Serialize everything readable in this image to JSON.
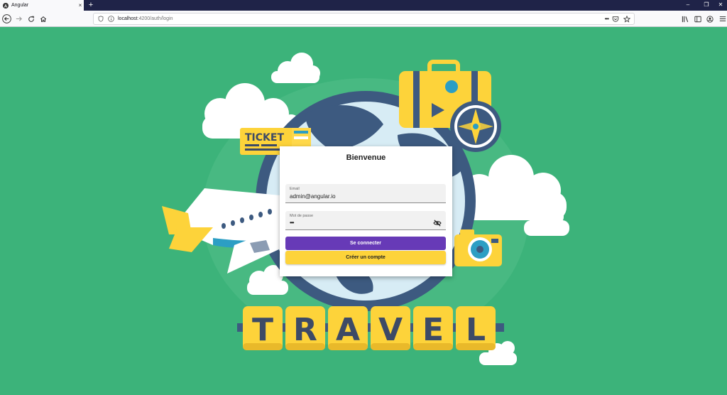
{
  "browser": {
    "tab_title": "Angular",
    "tab_close": "×",
    "new_tab": "+",
    "url_host": "localhost",
    "url_path": ":4200/auth/login",
    "more_actions": "•••",
    "window_minimize": "–",
    "window_restore": "❐",
    "window_close": "✕"
  },
  "illustration": {
    "ticket_label": "TICKET",
    "travel_letters": [
      "T",
      "R",
      "A",
      "V",
      "E",
      "L"
    ]
  },
  "login": {
    "title": "Bienvenue",
    "email_label": "Email",
    "email_value": "admin@angular.io",
    "password_label": "Mot de passe",
    "password_value": "•••",
    "submit_label": "Se connecter",
    "register_label": "Créer un compte"
  },
  "colors": {
    "background": "#3cb37a",
    "primary": "#673ab7",
    "accent": "#fdd33a",
    "globe_blue": "#3d5a80",
    "letters_text": "#3d4a66"
  },
  "icons": {
    "tab": "angular-icon",
    "back": "back-arrow-icon",
    "forward": "forward-arrow-icon",
    "reload": "reload-icon",
    "home": "home-icon",
    "shield": "shield-icon",
    "info": "info-icon",
    "pocket": "pocket-icon",
    "bookmark": "star-icon",
    "library": "library-icon",
    "sidebar": "sidebar-icon",
    "account": "account-icon",
    "menu": "hamburger-menu-icon",
    "visibility": "visibility-off-icon"
  }
}
